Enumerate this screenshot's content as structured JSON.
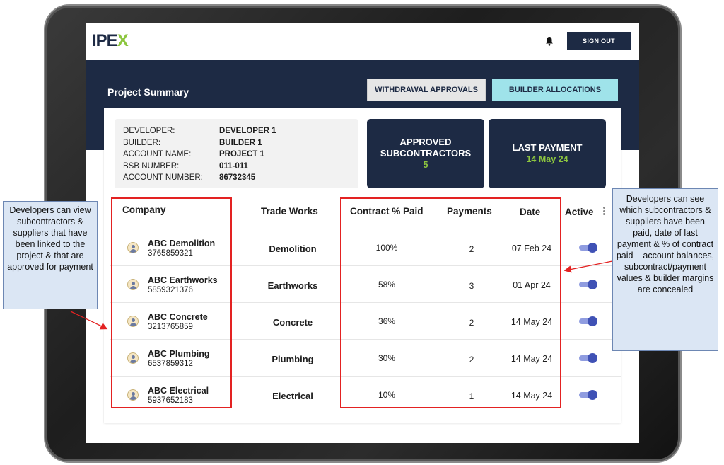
{
  "app": {
    "logo_prefix": "IPE",
    "logo_x": "X",
    "sign_out_label": "SIGN OUT"
  },
  "header": {
    "title": "Project Summary",
    "withdrawal_label": "WITHDRAWAL APPROVALS",
    "builder_label": "BUILDER ALLOCATIONS"
  },
  "info": {
    "rows": [
      {
        "label": "DEVELOPER:",
        "value": "DEVELOPER 1"
      },
      {
        "label": "BUILDER:",
        "value": "BUILDER 1"
      },
      {
        "label": "ACCOUNT NAME:",
        "value": "PROJECT 1"
      },
      {
        "label": "BSB NUMBER:",
        "value": "011-011"
      },
      {
        "label": "ACCOUNT NUMBER:",
        "value": "86732345"
      }
    ]
  },
  "stats": {
    "approved_line1": "APPROVED",
    "approved_line2": "SUBCONTRACTORS",
    "approved_value": "5",
    "last_payment_label": "LAST PAYMENT",
    "last_payment_value": "14 May 24"
  },
  "table": {
    "headers": {
      "company": "Company",
      "trade": "Trade Works",
      "contract": "Contract % Paid",
      "payments": "Payments",
      "date": "Date",
      "active": "Active"
    },
    "rows": [
      {
        "company": "ABC Demolition",
        "number": "3765859321",
        "trade": "Demolition",
        "pct": "100%",
        "payments": "2",
        "date": "07 Feb 24",
        "active": true
      },
      {
        "company": "ABC Earthworks",
        "number": "5859321376",
        "trade": "Earthworks",
        "pct": "58%",
        "payments": "3",
        "date": "01 Apr 24",
        "active": true
      },
      {
        "company": "ABC Concrete",
        "number": "3213765859",
        "trade": "Concrete",
        "pct": "36%",
        "payments": "2",
        "date": "14 May 24",
        "active": true
      },
      {
        "company": "ABC Plumbing",
        "number": "6537859312",
        "trade": "Plumbing",
        "pct": "30%",
        "payments": "2",
        "date": "14 May 24",
        "active": true
      },
      {
        "company": "ABC Electrical",
        "number": "5937652183",
        "trade": "Electrical",
        "pct": "10%",
        "payments": "1",
        "date": "14 May 24",
        "active": true
      }
    ]
  },
  "callouts": {
    "left": "Developers can view subcontractors & suppliers that have been linked to the project & that are approved for payment",
    "right": "Developers can see which subcontractors & suppliers have been paid, date of last payment & % of contract paid – account balances, subcontract/payment values & builder margins are concealed"
  },
  "colors": {
    "navy": "#1d2a44",
    "accent_green": "#8dc63f",
    "cyan_button": "#9fe3ea",
    "toggle_blue": "#3f51b5",
    "highlight_red": "#e32222",
    "callout_bg": "#dbe6f4"
  }
}
